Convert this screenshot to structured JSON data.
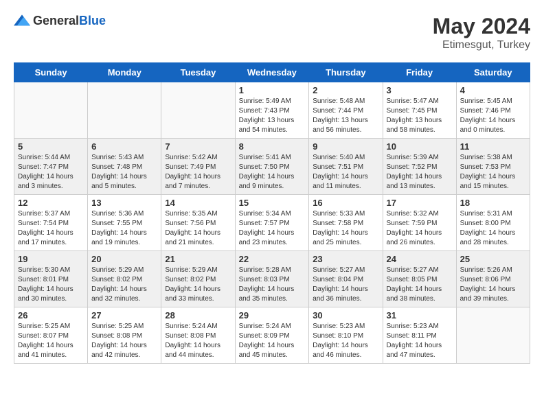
{
  "header": {
    "logo_general": "General",
    "logo_blue": "Blue",
    "month_year": "May 2024",
    "location": "Etimesgut, Turkey"
  },
  "weekdays": [
    "Sunday",
    "Monday",
    "Tuesday",
    "Wednesday",
    "Thursday",
    "Friday",
    "Saturday"
  ],
  "weeks": [
    [
      {
        "day": "",
        "info": ""
      },
      {
        "day": "",
        "info": ""
      },
      {
        "day": "",
        "info": ""
      },
      {
        "day": "1",
        "info": "Sunrise: 5:49 AM\nSunset: 7:43 PM\nDaylight: 13 hours\nand 54 minutes."
      },
      {
        "day": "2",
        "info": "Sunrise: 5:48 AM\nSunset: 7:44 PM\nDaylight: 13 hours\nand 56 minutes."
      },
      {
        "day": "3",
        "info": "Sunrise: 5:47 AM\nSunset: 7:45 PM\nDaylight: 13 hours\nand 58 minutes."
      },
      {
        "day": "4",
        "info": "Sunrise: 5:45 AM\nSunset: 7:46 PM\nDaylight: 14 hours\nand 0 minutes."
      }
    ],
    [
      {
        "day": "5",
        "info": "Sunrise: 5:44 AM\nSunset: 7:47 PM\nDaylight: 14 hours\nand 3 minutes."
      },
      {
        "day": "6",
        "info": "Sunrise: 5:43 AM\nSunset: 7:48 PM\nDaylight: 14 hours\nand 5 minutes."
      },
      {
        "day": "7",
        "info": "Sunrise: 5:42 AM\nSunset: 7:49 PM\nDaylight: 14 hours\nand 7 minutes."
      },
      {
        "day": "8",
        "info": "Sunrise: 5:41 AM\nSunset: 7:50 PM\nDaylight: 14 hours\nand 9 minutes."
      },
      {
        "day": "9",
        "info": "Sunrise: 5:40 AM\nSunset: 7:51 PM\nDaylight: 14 hours\nand 11 minutes."
      },
      {
        "day": "10",
        "info": "Sunrise: 5:39 AM\nSunset: 7:52 PM\nDaylight: 14 hours\nand 13 minutes."
      },
      {
        "day": "11",
        "info": "Sunrise: 5:38 AM\nSunset: 7:53 PM\nDaylight: 14 hours\nand 15 minutes."
      }
    ],
    [
      {
        "day": "12",
        "info": "Sunrise: 5:37 AM\nSunset: 7:54 PM\nDaylight: 14 hours\nand 17 minutes."
      },
      {
        "day": "13",
        "info": "Sunrise: 5:36 AM\nSunset: 7:55 PM\nDaylight: 14 hours\nand 19 minutes."
      },
      {
        "day": "14",
        "info": "Sunrise: 5:35 AM\nSunset: 7:56 PM\nDaylight: 14 hours\nand 21 minutes."
      },
      {
        "day": "15",
        "info": "Sunrise: 5:34 AM\nSunset: 7:57 PM\nDaylight: 14 hours\nand 23 minutes."
      },
      {
        "day": "16",
        "info": "Sunrise: 5:33 AM\nSunset: 7:58 PM\nDaylight: 14 hours\nand 25 minutes."
      },
      {
        "day": "17",
        "info": "Sunrise: 5:32 AM\nSunset: 7:59 PM\nDaylight: 14 hours\nand 26 minutes."
      },
      {
        "day": "18",
        "info": "Sunrise: 5:31 AM\nSunset: 8:00 PM\nDaylight: 14 hours\nand 28 minutes."
      }
    ],
    [
      {
        "day": "19",
        "info": "Sunrise: 5:30 AM\nSunset: 8:01 PM\nDaylight: 14 hours\nand 30 minutes."
      },
      {
        "day": "20",
        "info": "Sunrise: 5:29 AM\nSunset: 8:02 PM\nDaylight: 14 hours\nand 32 minutes."
      },
      {
        "day": "21",
        "info": "Sunrise: 5:29 AM\nSunset: 8:02 PM\nDaylight: 14 hours\nand 33 minutes."
      },
      {
        "day": "22",
        "info": "Sunrise: 5:28 AM\nSunset: 8:03 PM\nDaylight: 14 hours\nand 35 minutes."
      },
      {
        "day": "23",
        "info": "Sunrise: 5:27 AM\nSunset: 8:04 PM\nDaylight: 14 hours\nand 36 minutes."
      },
      {
        "day": "24",
        "info": "Sunrise: 5:27 AM\nSunset: 8:05 PM\nDaylight: 14 hours\nand 38 minutes."
      },
      {
        "day": "25",
        "info": "Sunrise: 5:26 AM\nSunset: 8:06 PM\nDaylight: 14 hours\nand 39 minutes."
      }
    ],
    [
      {
        "day": "26",
        "info": "Sunrise: 5:25 AM\nSunset: 8:07 PM\nDaylight: 14 hours\nand 41 minutes."
      },
      {
        "day": "27",
        "info": "Sunrise: 5:25 AM\nSunset: 8:08 PM\nDaylight: 14 hours\nand 42 minutes."
      },
      {
        "day": "28",
        "info": "Sunrise: 5:24 AM\nSunset: 8:08 PM\nDaylight: 14 hours\nand 44 minutes."
      },
      {
        "day": "29",
        "info": "Sunrise: 5:24 AM\nSunset: 8:09 PM\nDaylight: 14 hours\nand 45 minutes."
      },
      {
        "day": "30",
        "info": "Sunrise: 5:23 AM\nSunset: 8:10 PM\nDaylight: 14 hours\nand 46 minutes."
      },
      {
        "day": "31",
        "info": "Sunrise: 5:23 AM\nSunset: 8:11 PM\nDaylight: 14 hours\nand 47 minutes."
      },
      {
        "day": "",
        "info": ""
      }
    ]
  ]
}
